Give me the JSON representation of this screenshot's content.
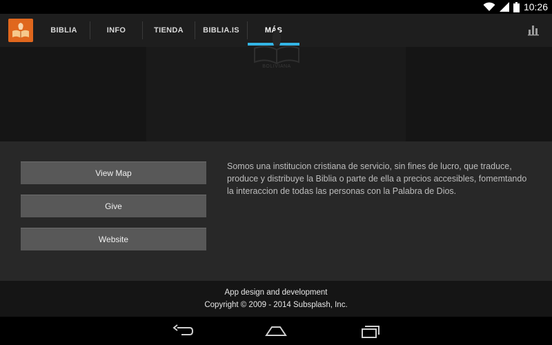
{
  "status_bar": {
    "time": "10:26",
    "icons": [
      "wifi-icon",
      "signal-icon",
      "battery-icon"
    ]
  },
  "header": {
    "logo_icon": "bible-logo-icon",
    "tabs": [
      {
        "label": "BIBLIA",
        "active": false
      },
      {
        "label": "INFO",
        "active": false
      },
      {
        "label": "TIENDA",
        "active": false
      },
      {
        "label": "BIBLIA.IS",
        "active": false
      },
      {
        "label": "MÁS",
        "active": true
      }
    ],
    "overflow_icon": "bar-chart-icon"
  },
  "banner": {
    "logo_text": "BOLIVIANA"
  },
  "actions": {
    "view_map": "View Map",
    "give": "Give",
    "website": "Website"
  },
  "description": "Somos una institucion cristiana de servicio, sin fines de lucro, que traduce, produce y distribuye la Biblia o parte de ella a precios accesibles, fomemtando la interaccion de todas las personas con la Palabra de Dios.",
  "footer": {
    "line1": "App design and development",
    "line2": "Copyright © 2009 - 2014 Subsplash, Inc."
  },
  "nav_bar": {
    "icons": [
      "back-icon",
      "home-icon",
      "recent-apps-icon"
    ]
  },
  "colors": {
    "accent": "#33b5e5",
    "logo_bg": "#e0671d",
    "header_bg": "#1e1e1e",
    "content_bg": "#282828",
    "button_bg": "#585858"
  }
}
